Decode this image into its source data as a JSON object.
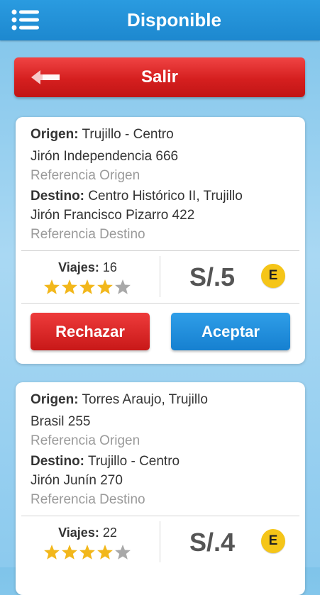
{
  "header": {
    "title": "Disponible",
    "menu_icon": "hamburger-menu-icon"
  },
  "exit_button": {
    "label": "Salir",
    "icon": "arrow-left-icon"
  },
  "labels": {
    "origen": "Origen:",
    "destino": "Destino:",
    "viajes": "Viajes:"
  },
  "colors": {
    "accent_blue": "#1d88cf",
    "danger_red": "#d51f1f",
    "badge_yellow": "#f5c518",
    "star_gold": "#f2b71b"
  },
  "requests": [
    {
      "origen": "Trujillo - Centro",
      "origen_address": "Jirón Independencia 666",
      "origen_reference": "Referencia Origen",
      "destino": "Centro Histórico II, Trujillo",
      "destino_address": "Jirón Francisco Pizarro 422",
      "destino_reference": "Referencia Destino",
      "viajes": "16",
      "rating": 4,
      "rating_max": 5,
      "price": "S/.5",
      "badge": "E",
      "reject_label": "Rechazar",
      "accept_label": "Aceptar"
    },
    {
      "origen": "Torres Araujo, Trujillo",
      "origen_address": "Brasil 255",
      "origen_reference": "Referencia Origen",
      "destino": "Trujillo - Centro",
      "destino_address": "Jirón Junín 270",
      "destino_reference": "Referencia Destino",
      "viajes": "22",
      "rating": 4,
      "rating_max": 5,
      "price": "S/.4",
      "badge": "E"
    }
  ]
}
